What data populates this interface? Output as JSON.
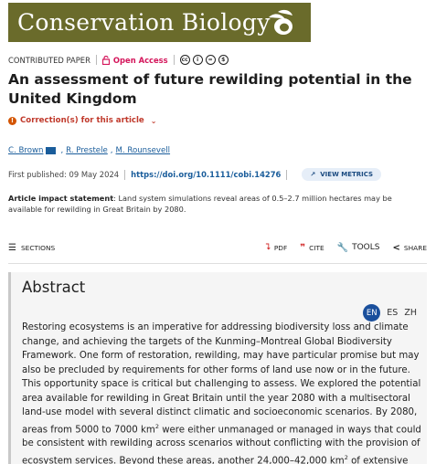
{
  "journal": {
    "name": "Conservation Biology",
    "logo_icon": "bird-logo-icon",
    "banner_color": "#6a6b2b"
  },
  "article_meta": {
    "type": "CONTRIBUTED PAPER",
    "access": "Open Access",
    "license_icons": [
      "cc-icon",
      "by-icon",
      "nd-icon",
      "nc-icon"
    ]
  },
  "title": "An assessment of future rewilding potential in the United Kingdom",
  "correction": {
    "label": "Correction(s) for this article"
  },
  "authors": [
    "C. Brown",
    "R. Prestele",
    "M. Rounsevell"
  ],
  "publication": {
    "first_published_label": "First published: 09 May 2024",
    "doi": "https://doi.org/10.1111/cobi.14276",
    "metrics_button": "VIEW METRICS"
  },
  "impact": {
    "label": "Article impact statement",
    "text": ": Land system simulations reveal areas of 0.5–2.7 million hectares may be available for rewilding in Great Britain by 2080."
  },
  "toolbar": {
    "sections": "SECTIONS",
    "pdf": "PDF",
    "cite": "CITE",
    "tools": "TOOLS",
    "share": "SHARE"
  },
  "abstract": {
    "heading": "Abstract",
    "languages": [
      "EN",
      "ES",
      "ZH"
    ],
    "text_part1": "Restoring ecosystems is an imperative for addressing biodiversity loss and climate change, and achieving the targets of the Kunming–Montreal Global Biodiversity Framework. One form of restoration, rewilding, may have particular promise but may also be precluded by requirements for other forms of land use now or in the future. This opportunity space is critical but challenging to assess. We explored the potential area available for rewilding in Great Britain until the year 2080 with a multisectoral land-use model with several distinct climatic and socioeconomic scenarios. By 2080, areas from 5000 to 7000 km",
    "sup1": "2",
    "text_part2": " were either unmanaged or managed in ways that could be consistent with rewilding across scenarios without conflicting with the provision of ecosystem services. Beyond these areas, another 24,000–42,000 km",
    "sup2": "2",
    "text_part3": " of extensive upland"
  }
}
